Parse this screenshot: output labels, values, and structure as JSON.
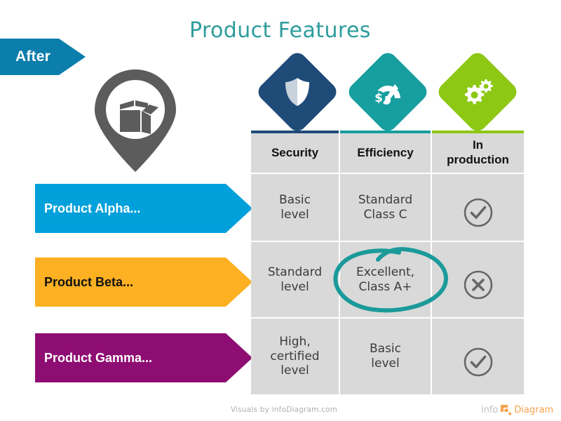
{
  "banner": {
    "label": "After",
    "color": "#0B7EAC"
  },
  "title": {
    "text": "Product Features",
    "color": "#2D9C9C"
  },
  "pin_icon": {
    "name": "package-box-pin-icon",
    "color": "#5C5C5C"
  },
  "columns": [
    {
      "id": "security",
      "header": "Security",
      "accent": "#1F4B79",
      "icon": "shield-icon"
    },
    {
      "id": "efficiency",
      "header": "Efficiency",
      "accent": "#179E9E",
      "icon": "speedometer-dollar-icon"
    },
    {
      "id": "in-production",
      "header": "In\nproduction",
      "accent": "#8DC814",
      "icon": "gears-icon"
    }
  ],
  "rows": [
    {
      "label": "Product Alpha...",
      "color": "#00A0DB",
      "text_color": "#ffffff",
      "security": "Basic\nlevel",
      "efficiency": "Standard\nClass C",
      "in_production": "check-circle-icon",
      "in_production_state": "yes"
    },
    {
      "label": "Product Beta...",
      "color": "#FDB022",
      "text_color": "#111111",
      "security": "Standard\nlevel",
      "efficiency": "Excellent,\nClass A+",
      "in_production": "cross-circle-icon",
      "in_production_state": "no"
    },
    {
      "label": "Product Gamma...",
      "color": "#8E0D72",
      "text_color": "#ffffff",
      "security": "High,\ncertified\nlevel",
      "efficiency": "Basic\nlevel",
      "in_production": "check-circle-icon",
      "in_production_state": "yes"
    }
  ],
  "highlight": {
    "target": "Excellent, Class A+",
    "shape": "hand-drawn-ellipse",
    "color": "#1C9A9A"
  },
  "footer": {
    "credit": "Visuals by infoDiagram.com",
    "logo_info": "info",
    "logo_diagram": "Diagram",
    "logo_accent": "#F5A24B"
  },
  "theme": {
    "cell_bg": "#D9D9D9",
    "cell_text": "#3C3C3C",
    "status_icon_color": "#666666",
    "background": "#ffffff"
  }
}
